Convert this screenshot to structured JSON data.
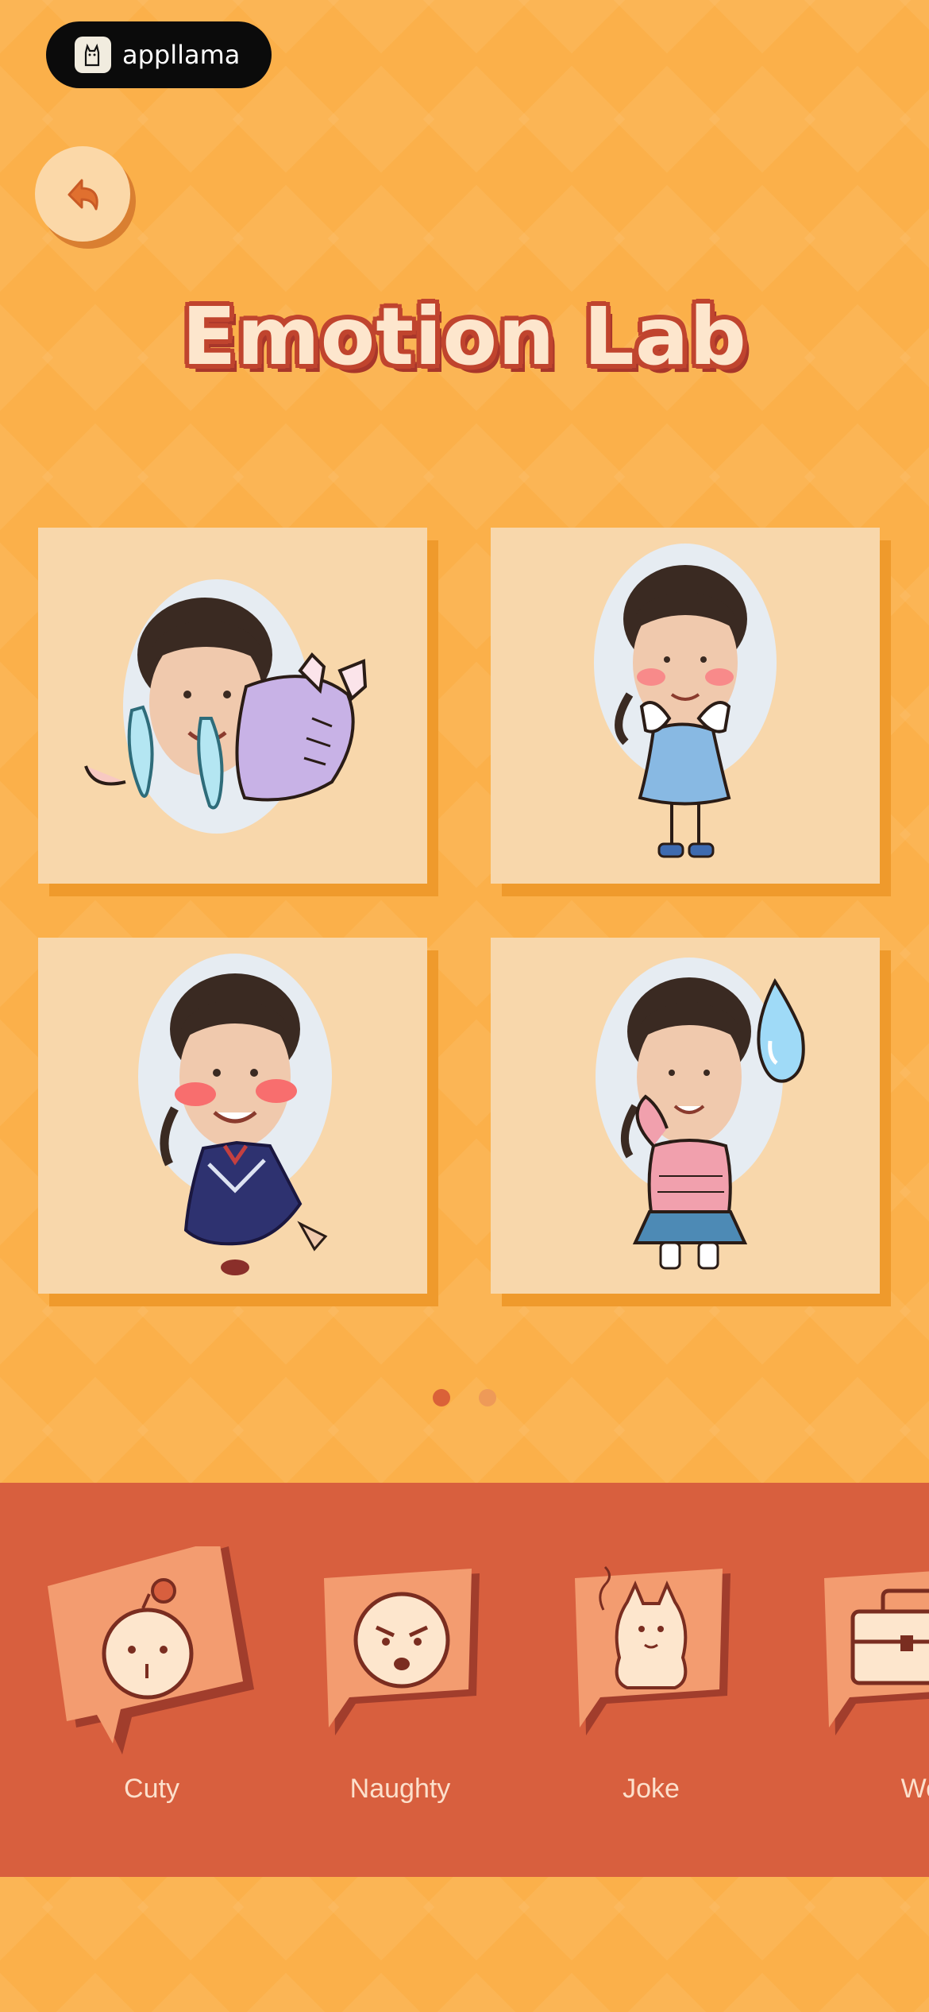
{
  "badge": {
    "text": "appllama",
    "logo_icon": "llama-icon"
  },
  "header": {
    "back_icon": "back-arrow-icon",
    "title": "Emotion Lab"
  },
  "stickers": [
    {
      "name": "crying-girl",
      "colors": {
        "outfit": "#c8b2e6",
        "tears": "#a8e1ee"
      }
    },
    {
      "name": "shy-girl-blue-dress",
      "colors": {
        "outfit": "#88b9e3",
        "blush": "#f88a8a"
      }
    },
    {
      "name": "blushing-girl-navy-uniform",
      "colors": {
        "outfit": "#2e3270",
        "blush": "#f86e6e"
      }
    },
    {
      "name": "sweating-girl-pink-sweater",
      "colors": {
        "outfit": "#f1a0ad",
        "skirt": "#4d8ab5",
        "drop": "#9fdaf7"
      }
    }
  ],
  "pagination": {
    "total": 2,
    "active": 0
  },
  "categories": [
    {
      "label": "Cuty",
      "icon": "cute-face-icon"
    },
    {
      "label": "Naughty",
      "icon": "naughty-face-icon"
    },
    {
      "label": "Joke",
      "icon": "llama-joke-icon"
    },
    {
      "label": "Work",
      "icon": "briefcase-icon"
    }
  ],
  "colors": {
    "background": "#fbb04a",
    "tray": "#d85f3e",
    "title_fill": "#fde6cd",
    "title_stroke": "#c0442e",
    "card": "#f8d7ab"
  }
}
